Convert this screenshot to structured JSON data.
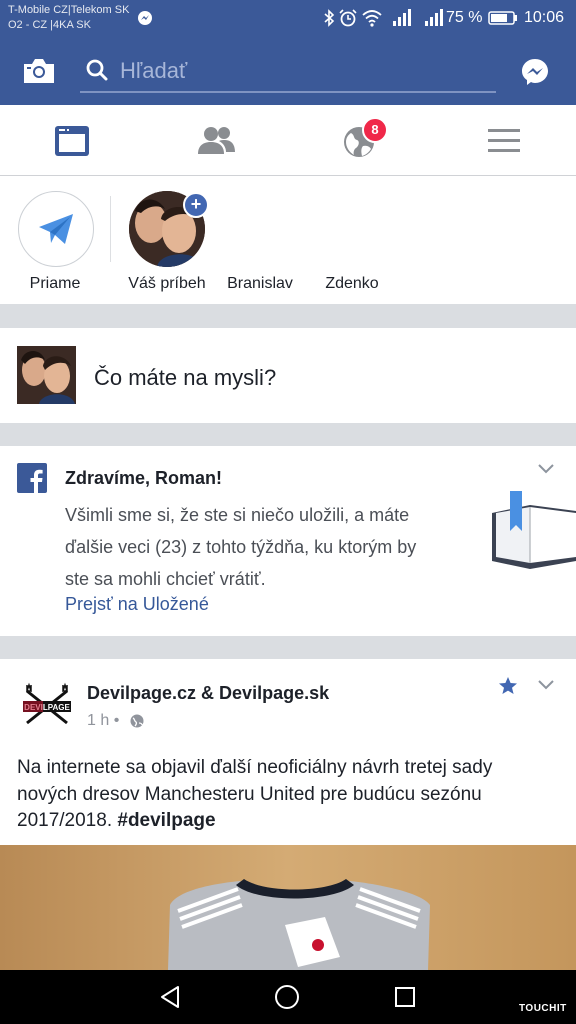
{
  "status_bar": {
    "carrier_line1": "T-Mobile CZ|Telekom SK",
    "carrier_line2": "O2 - CZ |4KA SK",
    "battery": "75 %",
    "time": "10:06"
  },
  "search": {
    "placeholder": "Hľadať"
  },
  "nav": {
    "notifications_badge": "8"
  },
  "stories": {
    "items": [
      {
        "label": "Priame"
      },
      {
        "label": "Váš príbeh"
      },
      {
        "label": "Branislav"
      },
      {
        "label": "Zdenko"
      }
    ]
  },
  "composer": {
    "prompt": "Čo máte na mysli?"
  },
  "saved_card": {
    "title": "Zdravíme, Roman!",
    "body_line1": "Všimli sme si, že ste si niečo uložili, a máte",
    "body_line2": "ďalšie veci (23) z tohto týždňa, ku ktorým by",
    "body_line3": "ste sa mohli chcieť vrátiť.",
    "link": "Prejsť na Uložené"
  },
  "post": {
    "author": "Devilpage.cz & Devilpage.sk",
    "time": "1 h",
    "separator": "•",
    "text_line1": "Na internete sa objavil ďalší neoficiálny návrh tretej sady",
    "text_line2": "nových dresov Manchesteru United pre budúcu sezónu",
    "text_line3_plain": "2017/2018. ",
    "text_line3_tag": "#devilpage"
  },
  "watermark": "TOUCHIT",
  "colors": {
    "brand": "#3b5998",
    "badge": "#f02849",
    "link": "#365899"
  }
}
